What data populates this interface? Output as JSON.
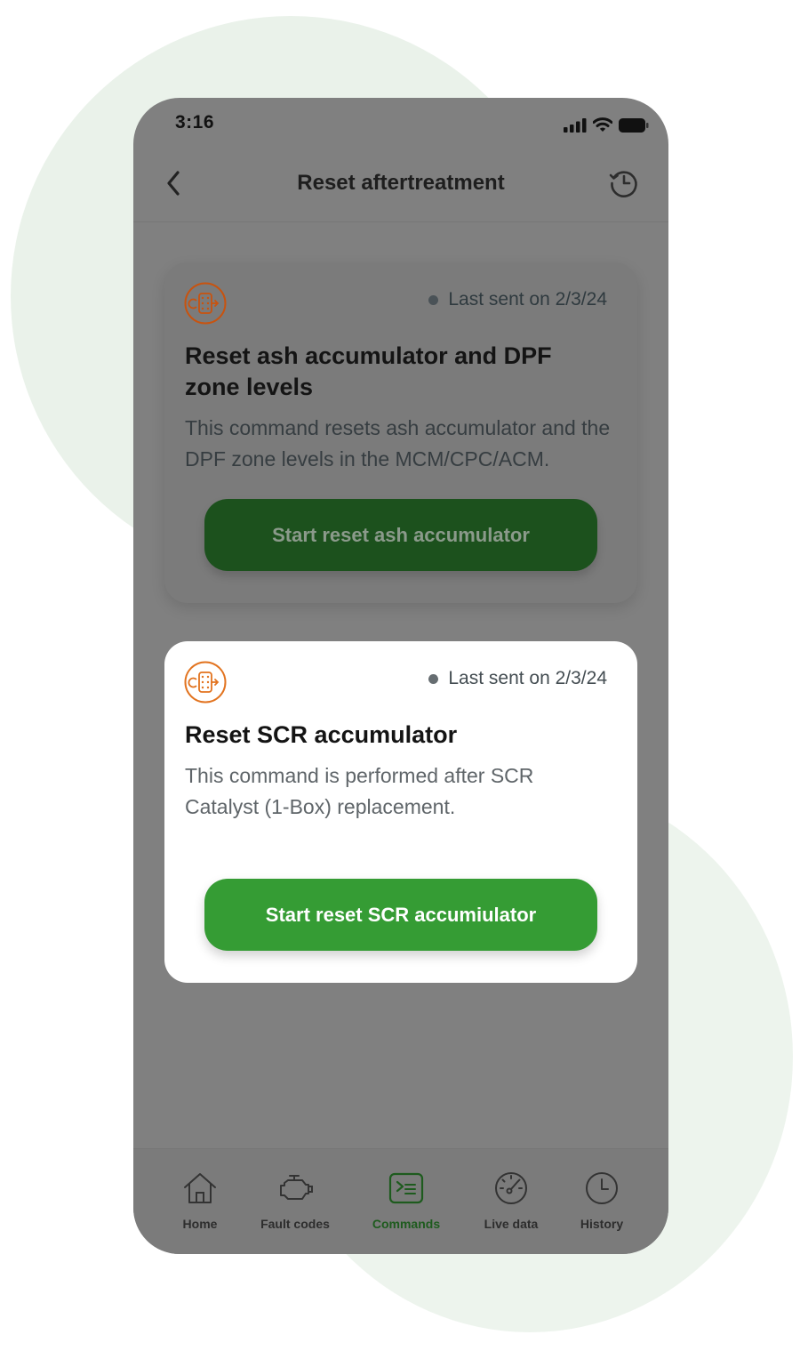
{
  "status_bar": {
    "time": "3:16"
  },
  "header": {
    "title": "Reset aftertreatment",
    "back_icon": "chevron-left-icon",
    "history_icon": "clock-history-icon"
  },
  "cards": [
    {
      "icon": "filter-reset-icon",
      "last_sent": "Last sent on 2/3/24",
      "title": "Reset ash accumulator and DPF zone levels",
      "description": "This command resets ash accumulator and the DPF zone levels in the MCM/CPC/ACM.",
      "button_label": "Start reset ash accumulator",
      "state": "dimmed"
    },
    {
      "icon": "filter-reset-icon",
      "last_sent": "Last sent on 2/3/24",
      "title": "Reset SCR accumulator",
      "description": "This command is performed after SCR Catalyst (1-Box) replacement.",
      "button_label": "Start reset SCR accumiulator",
      "state": "active"
    }
  ],
  "tab_bar": {
    "items": [
      {
        "label": "Home",
        "icon": "home-icon"
      },
      {
        "label": "Fault codes",
        "icon": "engine-icon"
      },
      {
        "label": "Commands",
        "icon": "terminal-icon",
        "active": true
      },
      {
        "label": "Live data",
        "icon": "gauge-icon"
      },
      {
        "label": "History",
        "icon": "clock-icon"
      }
    ]
  },
  "colors": {
    "brand_green": "#359c34",
    "accent_orange": "#e2731f",
    "overlay_gray": "#808080",
    "background_circle": "#eaf2ea"
  }
}
